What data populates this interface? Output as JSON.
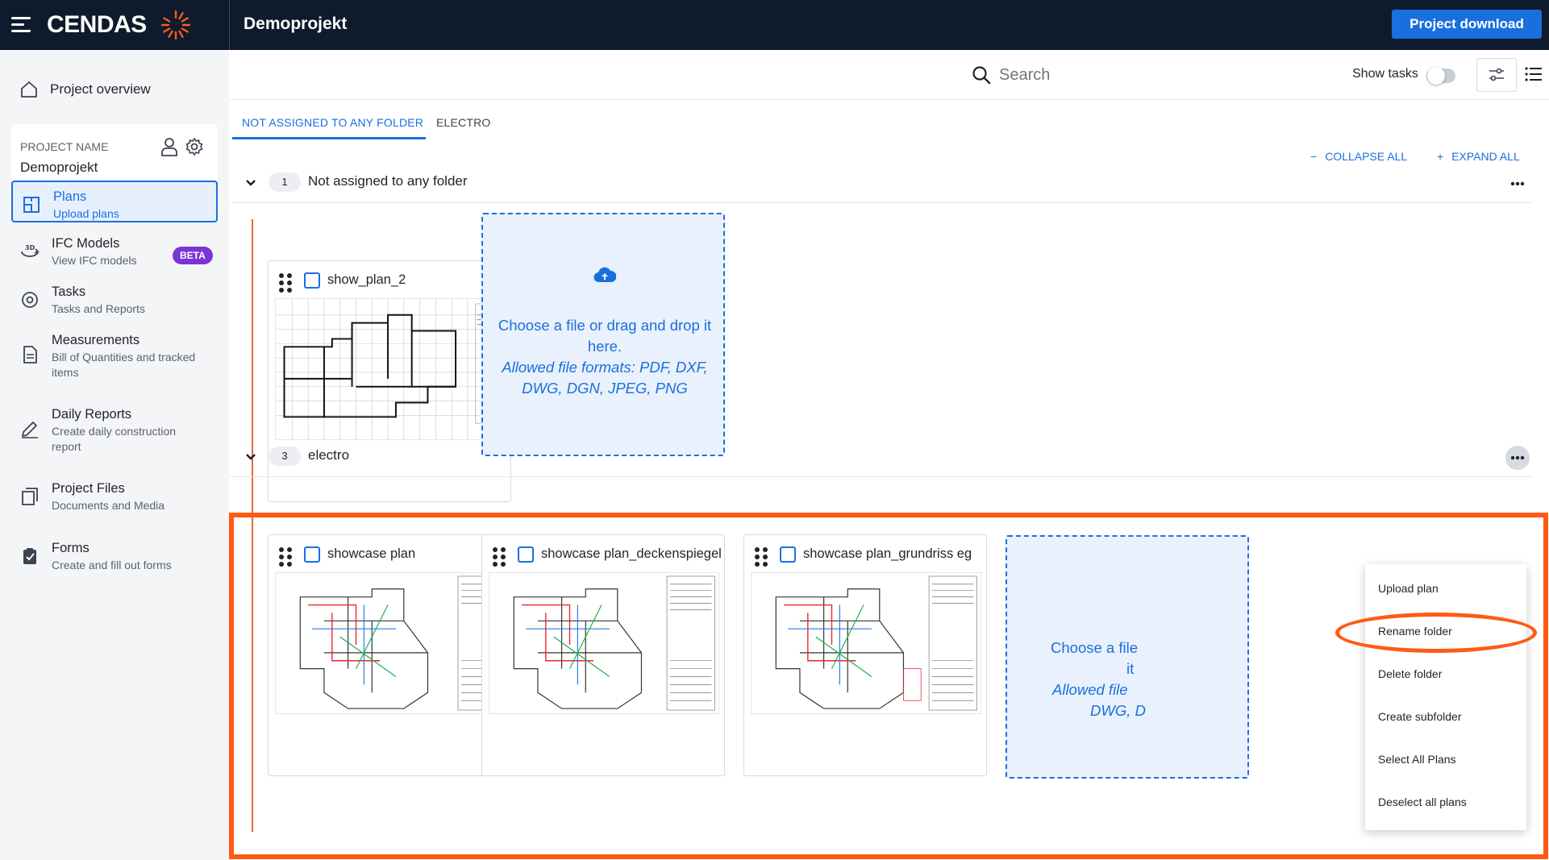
{
  "header": {
    "logo": "CENDAS",
    "project_title": "Demoprojekt",
    "download_label": "Project download"
  },
  "sidebar": {
    "overview": "Project overview",
    "project_card": {
      "label": "PROJECT NAME",
      "value": "Demoprojekt"
    },
    "items": [
      {
        "title": "Plans",
        "subtitle": "Upload plans"
      },
      {
        "title": "IFC Models",
        "subtitle": "View IFC models",
        "badge": "BETA"
      },
      {
        "title": "Tasks",
        "subtitle": "Tasks and Reports"
      },
      {
        "title": "Measurements",
        "subtitle": "Bill of Quantities and tracked items"
      },
      {
        "title": "Daily Reports",
        "subtitle": "Create daily construction report"
      },
      {
        "title": "Project Files",
        "subtitle": "Documents and Media"
      },
      {
        "title": "Forms",
        "subtitle": "Create and fill out forms"
      }
    ]
  },
  "toolbar": {
    "search_placeholder": "Search",
    "show_tasks": "Show tasks",
    "show_tasks_on": false
  },
  "tabs": [
    "NOT ASSIGNED TO ANY FOLDER",
    "ELECTRO"
  ],
  "actions": {
    "collapse_all": "COLLAPSE ALL",
    "expand_all": "EXPAND ALL"
  },
  "folders": [
    {
      "count": "1",
      "name": "Not assigned to any folder",
      "plans": [
        "show_plan_2"
      ]
    },
    {
      "count": "3",
      "name": "electro",
      "plans": [
        "showcase plan",
        "showcase plan_deckenspiegel",
        "showcase plan_grundriss eg"
      ]
    }
  ],
  "dropzone": {
    "line1": "Choose a file or drag and drop it here.",
    "line2": "Allowed file formats: PDF, DXF, DWG, DGN, JPEG, PNG",
    "clipped_line1": "Choose a file",
    "clipped_line1b": "it",
    "clipped_line2": "Allowed file",
    "clipped_line2b": "DWG, D"
  },
  "context_menu": [
    "Upload plan",
    "Rename folder",
    "Delete folder",
    "Create subfolder",
    "Select All Plans",
    "Deselect all plans"
  ],
  "colors": {
    "brand_blue": "#1a6fde",
    "accent_orange": "#ff5a14",
    "topbar": "#0e1b2d",
    "beta": "#7a35d6"
  }
}
